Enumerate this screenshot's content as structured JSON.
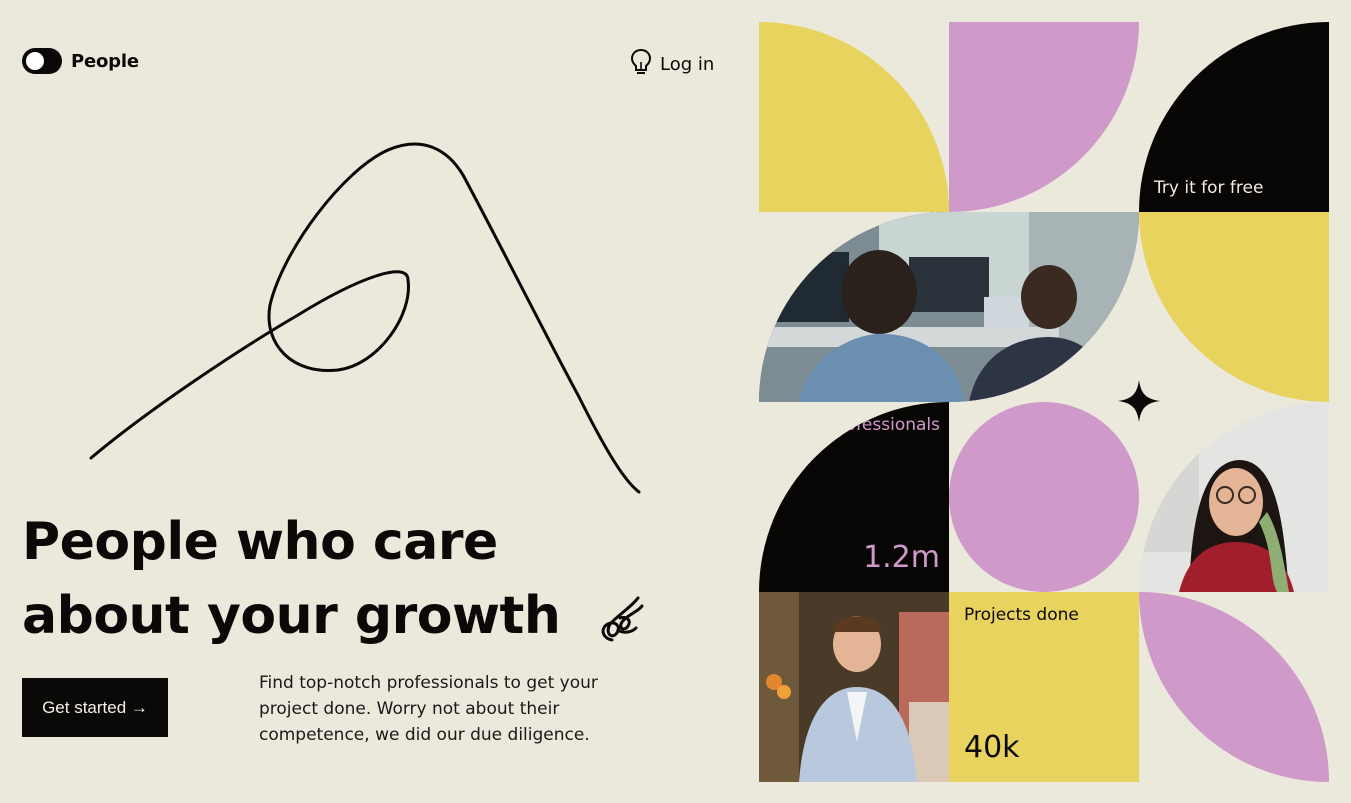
{
  "header": {
    "brand": "People",
    "login_label": "Log in"
  },
  "hero": {
    "title_line1": "People who care",
    "title_line2": "about your growth",
    "cta_label": "Get started →",
    "description": "Find top-notch professionals to get your project done. Worry not about their competence, we did our due diligence."
  },
  "grid": {
    "try_free": "Try it for free",
    "professionals_label": "Professionals",
    "professionals_value": "1.2m",
    "projects_label": "Projects done",
    "projects_value": "40k"
  },
  "colors": {
    "background": "#ebe8dc",
    "yellow": "#e9d35f",
    "purple": "#cf99c9",
    "black": "#080605",
    "accent_text": "#cf99c9"
  },
  "icons": [
    "toggle-logo-icon",
    "bulb-icon",
    "scribble-decoration",
    "doodle-icon",
    "sparkle-icon"
  ]
}
